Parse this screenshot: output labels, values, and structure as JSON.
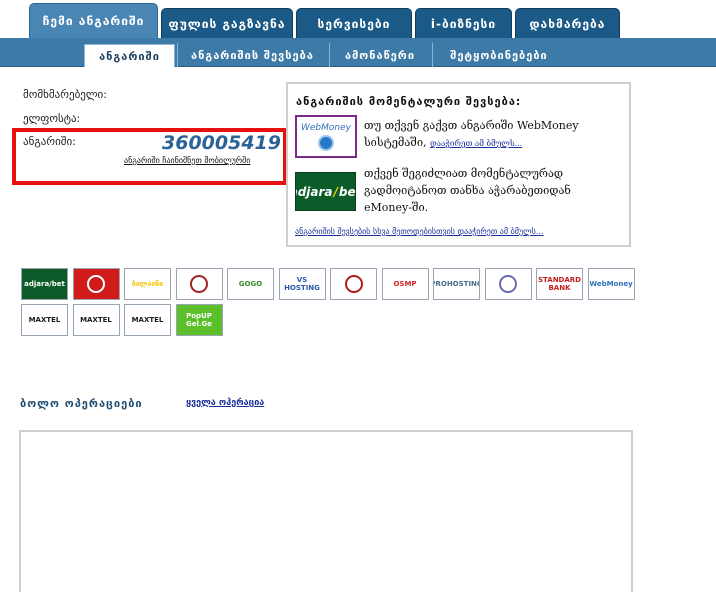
{
  "nav": {
    "main_tabs": [
      {
        "label": "ჩემი ანგარიში",
        "active": true
      },
      {
        "label": "ფულის გაგზავნა",
        "active": false
      },
      {
        "label": "სერვისები",
        "active": false
      },
      {
        "label": "i-ბიზნესი",
        "active": false
      },
      {
        "label": "დახმარება",
        "active": false
      }
    ],
    "sub_tabs": [
      {
        "label": "ანგარიში",
        "active": true
      },
      {
        "label": "ანგარიშის შევსება",
        "active": false
      },
      {
        "label": "ამონაწერი",
        "active": false
      },
      {
        "label": "შეტყობინებები",
        "active": false
      }
    ]
  },
  "account": {
    "user_label": "მომხმარებელი:",
    "email_label": "ელფოსტა:",
    "account_label": "ანგარიში:",
    "account_number": "360005419",
    "mobile_link": "ანგარიში ჩაინიშნეთ მობილურში"
  },
  "info_panel": {
    "title": "ანგარიშის მომენტალური შევსება:",
    "webmoney_logo": "WebMoney",
    "webmoney_text_line1": "თუ თქვენ გაქვთ ანგარიში WebMoney",
    "webmoney_text_line2": "სისტემაში,",
    "webmoney_link": "დააჭირეთ ამ ბმულს...",
    "adjarabet_logo_a": "adjara",
    "adjarabet_logo_b": "bet",
    "adjarabet_text_line1": "თქვენ შეგიძლიათ მომენტალურად",
    "adjarabet_text_line2": "გადმოიტანოთ თანხა აჭარაბეთიდან",
    "adjarabet_text_line3": "eMoney-ში.",
    "other_methods_link": "ანგარიშის შევსების სხვა მეთოდებისთვის დააჭირეთ ამ ბმულს..."
  },
  "payment_logos": [
    {
      "name": "adjarabet",
      "text": "adjara/bet",
      "color": "#0c5c2a"
    },
    {
      "name": "liberty",
      "text": "",
      "color": "#d11a1a"
    },
    {
      "name": "beeline",
      "text": "ბილაინი",
      "color": "#f3c400"
    },
    {
      "name": "payment-kiosk",
      "text": "",
      "color": "#a32222"
    },
    {
      "name": "gogo",
      "text": "GOGO",
      "color": "#3a8a2a"
    },
    {
      "name": "vs-hosting",
      "text": "VS HOSTING",
      "color": "#2a5aa8"
    },
    {
      "name": "bank-one",
      "text": "",
      "color": "#b31b1b"
    },
    {
      "name": "osmp",
      "text": "OSMP",
      "color": "#d42a2a"
    },
    {
      "name": "web-hosting",
      "text": "PROHOSTING",
      "color": "#4a6a8a"
    },
    {
      "name": "bank-two",
      "text": "",
      "color": "#6b6bb5"
    },
    {
      "name": "standard-bank",
      "text": "STANDARD BANK",
      "color": "#c21d1d"
    },
    {
      "name": "webmoney",
      "text": "WebMoney",
      "color": "#3070b8"
    },
    {
      "name": "maxtel-1",
      "text": "MAXTEL",
      "color": "#1a1a1a"
    },
    {
      "name": "maxtel-2",
      "text": "MAXTEL",
      "color": "#1a1a1a"
    },
    {
      "name": "maxtel-3",
      "text": "MAXTEL",
      "color": "#1a1a1a"
    },
    {
      "name": "popup-gel",
      "text": "PopUP Gel.Ge",
      "color": "#5bbf2a"
    }
  ],
  "operations": {
    "title": "ბოლო ოპერაციები",
    "all_link": "ყველა ოპერაცია"
  },
  "colors": {
    "tab_bg": "#1b5a86",
    "tab_active": "#4a86b4",
    "highlight_border": "#e61010",
    "link": "#1c2f9c"
  }
}
